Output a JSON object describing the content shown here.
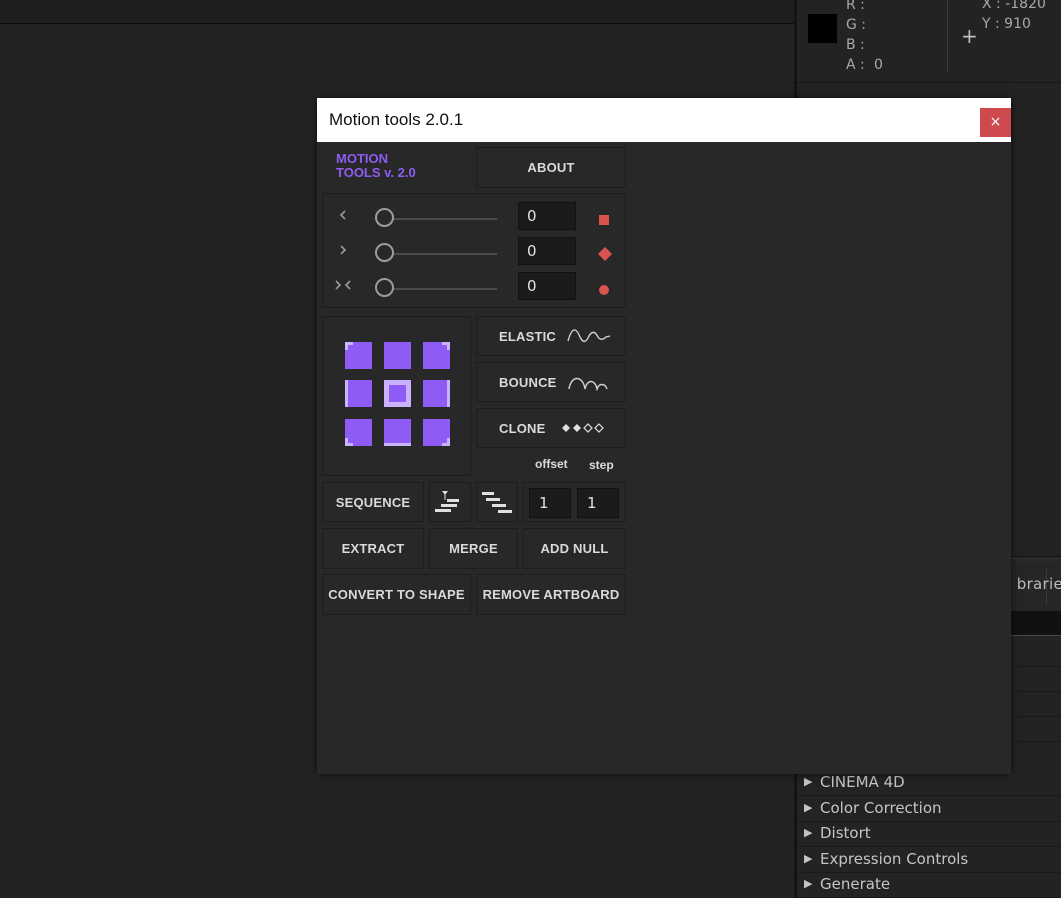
{
  "dialog": {
    "title": "Motion tools 2.0.1",
    "close_label": "×",
    "logo": "MOTION\nTOOLS v. 2.0",
    "about_label": "ABOUT",
    "sliders": [
      {
        "icon": "chevron-left-icon",
        "glyph": "‹",
        "value": "0",
        "key_icon": "square-keyframe-icon"
      },
      {
        "icon": "chevron-right-icon",
        "glyph": "›",
        "value": "0",
        "key_icon": "diamond-keyframe-icon"
      },
      {
        "icon": "collapse-icon",
        "glyph": "›‹",
        "value": "0",
        "key_icon": "circle-keyframe-icon"
      }
    ],
    "elastic_label": "ELASTIC",
    "bounce_label": "BOUNCE",
    "clone_label": "CLONE",
    "offset_label": "offset",
    "step_label": "step",
    "sequence_label": "SEQUENCE",
    "offset_value": "1",
    "step_value": "1",
    "extract_label": "EXTRACT",
    "merge_label": "MERGE",
    "add_null_label": "ADD NULL",
    "convert_label": "CONVERT TO SHAPE",
    "remove_artboard_label": "REMOVE ARTBOARD",
    "accent_color": "#8e5bf5",
    "key_color": "#d9534f"
  },
  "info": {
    "r": "R :",
    "g": "G :",
    "b": "B :",
    "a": "A :",
    "a_value": "0",
    "x": "X : -1820",
    "y": "Y : 910"
  },
  "libraries_tab": "brarie",
  "effects": [
    "CINEMA 4D",
    "Color Correction",
    "Distort",
    "Expression Controls",
    "Generate"
  ]
}
